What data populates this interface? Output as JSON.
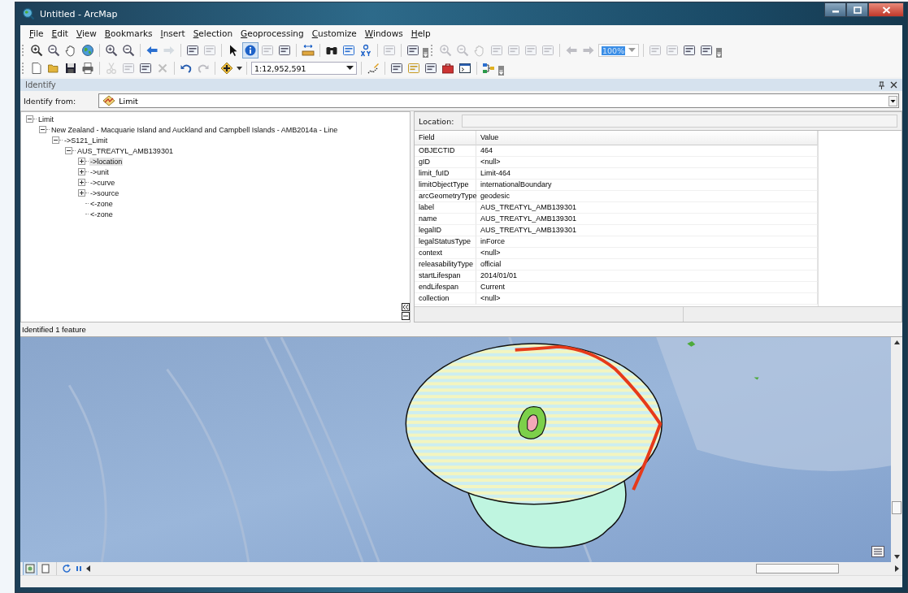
{
  "window": {
    "title": "Untitled - ArcMap"
  },
  "menu": [
    "File",
    "Edit",
    "View",
    "Bookmarks",
    "Insert",
    "Selection",
    "Geoprocessing",
    "Customize",
    "Windows",
    "Help"
  ],
  "toolbar": {
    "zoom_combo": {
      "value": "100%",
      "disabled": true
    },
    "scale_combo": {
      "value": "1:12,952,591"
    }
  },
  "identify": {
    "title": "Identify",
    "from_label": "Identify from:",
    "from_value": "Limit",
    "location_label": "Location:",
    "tree": [
      {
        "label": "Limit",
        "expanded": true,
        "selected": false,
        "children": [
          {
            "label": "New Zealand - Macquarie Island and Auckland and Campbell Islands - AMB2014a - Line",
            "expanded": true,
            "selected": false,
            "children": [
              {
                "label": "->S121_Limit",
                "expanded": true,
                "selected": false,
                "children": [
                  {
                    "label": "AUS_TREATYL_AMB139301",
                    "expanded": true,
                    "selected": false,
                    "children": [
                      {
                        "label": "->location",
                        "expanded": false,
                        "selected": true
                      },
                      {
                        "label": "->unit",
                        "expanded": false,
                        "selected": false
                      },
                      {
                        "label": "->curve",
                        "expanded": false,
                        "selected": false
                      },
                      {
                        "label": "->source",
                        "expanded": false,
                        "selected": false
                      },
                      {
                        "label": "<-zone",
                        "selected": false
                      },
                      {
                        "label": "<-zone",
                        "selected": false
                      }
                    ]
                  }
                ]
              }
            ]
          }
        ]
      }
    ],
    "table": {
      "columns": [
        "Field",
        "Value"
      ],
      "rows": [
        [
          "OBJECTID",
          "464"
        ],
        [
          "gID",
          "<null>"
        ],
        [
          "limit_fuID",
          "Limit-464"
        ],
        [
          "limitObjectType",
          "internationalBoundary"
        ],
        [
          "arcGeometryType",
          "geodesic"
        ],
        [
          "label",
          "AUS_TREATYL_AMB139301"
        ],
        [
          "name",
          "AUS_TREATYL_AMB139301"
        ],
        [
          "legalID",
          "AUS_TREATYL_AMB139301"
        ],
        [
          "legalStatusType",
          "inForce"
        ],
        [
          "context",
          "<null>"
        ],
        [
          "releasabilityType",
          "official"
        ],
        [
          "startLifespan",
          "2014/01/01"
        ],
        [
          "endLifespan",
          "Current"
        ],
        [
          "collection",
          "<null>"
        ]
      ]
    },
    "status": "Identified 1 feature"
  }
}
